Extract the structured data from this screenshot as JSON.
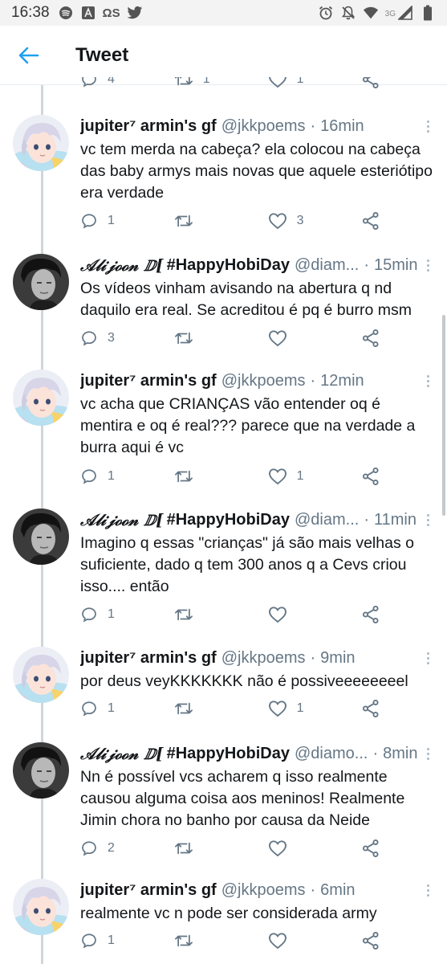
{
  "status_bar": {
    "time": "16:38",
    "carrier_label": "ΩS",
    "network_label": "3G"
  },
  "header": {
    "title": "Tweet"
  },
  "previous_tweet_counts": {
    "replies": "4",
    "retweets": "1",
    "likes": "1"
  },
  "tweets": [
    {
      "author": "jupiter⁷ armin's gf",
      "handle": "@jkkpoems",
      "time": "16min",
      "text": "vc tem merda na cabeça? ela colocou na cabeça das baby armys mais novas que aquele esteriótipo era verdade",
      "replies": "1",
      "retweets": "",
      "likes": "3"
    },
    {
      "author_deco": "𝒜𝓁𝒾𝒿ℴℴ𝓃 ⅅ[",
      "author": "#HappyHobiDay",
      "handle": "@diam...",
      "time": "15min",
      "text": "Os vídeos vinham avisando na abertura q nd daquilo era real. Se acreditou é pq é burro msm",
      "replies": "3",
      "retweets": "",
      "likes": ""
    },
    {
      "author": "jupiter⁷ armin's gf",
      "handle": "@jkkpoems",
      "time": "12min",
      "text": "vc acha que CRIANÇAS vão entender oq é mentira e oq é real??? parece que na verdade a burra aqui é vc",
      "replies": "1",
      "retweets": "",
      "likes": "1"
    },
    {
      "author_deco": "𝒜𝓁𝒾𝒿ℴℴ𝓃 ⅅ[",
      "author": "#HappyHobiDay",
      "handle": "@diam...",
      "time": "11min",
      "text": "Imagino q essas \"crianças\" já são mais velhas o suficiente, dado q tem 300 anos q a Cevs criou isso.... então",
      "replies": "1",
      "retweets": "",
      "likes": ""
    },
    {
      "author": "jupiter⁷ armin's gf",
      "handle": "@jkkpoems",
      "time": "9min",
      "text": "por deus veyKKKKKKK não é possiveeeeeeeel",
      "replies": "1",
      "retweets": "",
      "likes": "1"
    },
    {
      "author_deco": "𝒜𝓁𝒾𝒿ℴℴ𝓃 ⅅ[",
      "author": "#HappyHobiDay",
      "handle": "@diamo...",
      "time": "8min",
      "text": "Nn é possível vcs acharem q isso realmente causou alguma coisa aos meninos! Realmente Jimin chora no banho por causa da Neide",
      "replies": "2",
      "retweets": "",
      "likes": ""
    },
    {
      "author": "jupiter⁷ armin's gf",
      "handle": "@jkkpoems",
      "time": "6min",
      "text": "realmente vc n pode ser considerada army",
      "replies": "1",
      "retweets": "",
      "likes": ""
    }
  ]
}
